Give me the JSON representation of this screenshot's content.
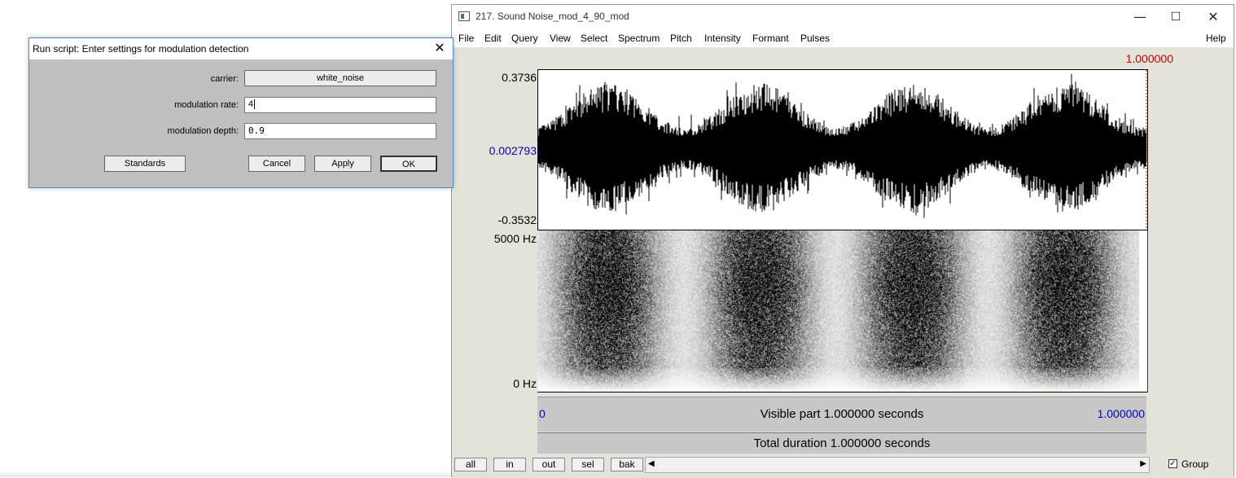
{
  "editor": {
    "title": "217. Sound Noise_mod_4_90_mod",
    "window_controls": {
      "minimize": "—",
      "maximize": "☐",
      "close": "✕"
    },
    "menu": [
      "File",
      "Edit",
      "Query",
      "View",
      "Select",
      "Spectrum",
      "Pitch",
      "Intensity",
      "Formant",
      "Pulses"
    ],
    "help": "Help",
    "cursor_time": "1.000000",
    "waveform": {
      "max_label": "0.3736",
      "mid_label": "0.002793",
      "min_label": "-0.3532"
    },
    "spectrogram": {
      "top_label": "5000 Hz",
      "bottom_label": "0 Hz"
    },
    "time_start": "0",
    "visible_part": "Visible part 1.000000 seconds",
    "time_end": "1.000000",
    "total_duration": "Total duration 1.000000 seconds",
    "buttons": [
      "all",
      "in",
      "out",
      "sel",
      "bak"
    ],
    "group_label": "Group",
    "group_checked": true,
    "colors": {
      "red": "#cc0000",
      "blue": "#0000cc"
    }
  },
  "dialog": {
    "title": "Run script: Enter settings for modulation detection",
    "close": "✕",
    "fields": {
      "carrier_label": "carrier:",
      "carrier_value": "white_noise",
      "rate_label": "modulation rate:",
      "rate_value": "4",
      "depth_label": "modulation depth:",
      "depth_value": "0.9"
    },
    "buttons": {
      "standards": "Standards",
      "cancel": "Cancel",
      "apply": "Apply",
      "ok": "OK"
    }
  }
}
